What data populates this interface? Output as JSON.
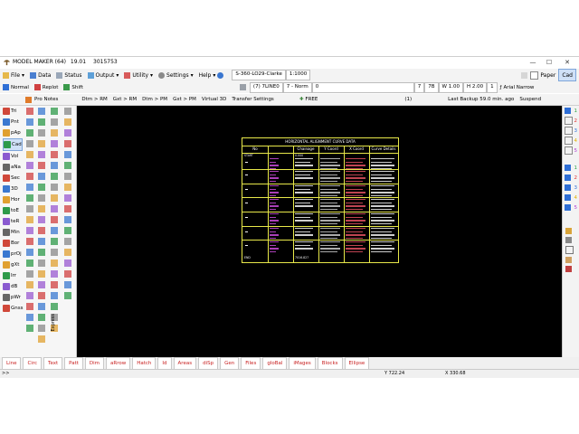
{
  "titlebar": {
    "app_name": "MODEL MAKER (64)",
    "version": "19.01",
    "code": "3015753",
    "minimize": "—",
    "maximize": "☐",
    "close": "✕"
  },
  "menubar": {
    "items": [
      "File",
      "Data",
      "Status",
      "Output",
      "Utility",
      "Settings",
      "Help"
    ],
    "crs": "S-360-LO29-Clarke",
    "scale": "1:1000",
    "paper": "Paper",
    "cad": "Cad"
  },
  "toolbar2": {
    "items": [
      "Normal",
      "Replot",
      "Shift"
    ],
    "layer": "(7) 7LINE0",
    "linestyle": "7 - Norm",
    "line_value": "0",
    "num": "7",
    "text_style": "7B",
    "width": "W 1.00",
    "height": "H 2.00",
    "count": "1",
    "font": "Arial Narrow"
  },
  "toolbar3": {
    "pro_notes": "Pro Notes",
    "items": [
      "Dtm > RM",
      "Gxt > RM",
      "Dtm > PM",
      "Gxt > PM",
      "Virtual 3D",
      "Transfer Settings"
    ],
    "free": "FREE",
    "slot": "(1)",
    "backup": "Last Backup 59.0 min. ago",
    "suspend": "Suspend"
  },
  "leftpanel": {
    "col1": [
      "Tri",
      "Pnt",
      "pAp",
      "Cad",
      "Vol",
      "aNa",
      "Sec",
      "3D",
      "Hor",
      "toE",
      "teR",
      "Min",
      "Bor",
      "prOj",
      "gXt",
      "Irr",
      "dB",
      "pWr",
      "Gnss"
    ],
    "express": "Express"
  },
  "rightpanel": {
    "nums": [
      "1",
      "2",
      "3",
      "4",
      "5",
      "1",
      "2",
      "3",
      "4",
      "5"
    ]
  },
  "canvas_table": {
    "title": "HORIZONTAL ALIGNMENT CURVE DATA",
    "headers": [
      "No",
      "Chainage",
      "Y Coord",
      "X Coord",
      "Curve Details"
    ],
    "start_row": "START",
    "end_row": "END",
    "first_chainage": "0.000",
    "last_chainage": "7016.827"
  },
  "tabs": [
    "Line",
    "Circ",
    "Text",
    "Patt",
    "Dim",
    "aRrow",
    "Hatch",
    "Id",
    "Areas",
    "diSp",
    "Gen",
    "Files",
    "gloBal",
    "iMages",
    "Blocks",
    "Ellipse"
  ],
  "statusbar": {
    "prompt": ">>",
    "y": "Y 722.24",
    "x": "X 330.68"
  },
  "colors": {
    "canvas": "#000000",
    "table_border": "#e8e84a",
    "tab_text": "#c82020",
    "layer_colors": [
      "#2ea043",
      "#e03030",
      "#2f6fd6",
      "#e0b000",
      "#b03ad0"
    ]
  }
}
